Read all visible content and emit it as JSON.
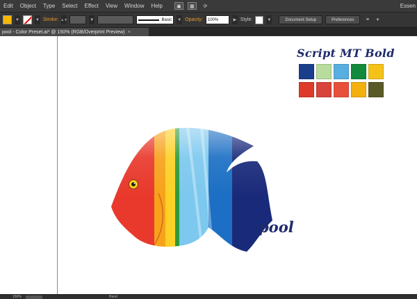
{
  "menu": {
    "items": [
      "Edit",
      "Object",
      "Type",
      "Select",
      "Effect",
      "View",
      "Window",
      "Help"
    ],
    "workspace": "Essen"
  },
  "control": {
    "stroke_label": "Stroke:",
    "brush_label": "Basic",
    "opacity_label": "Opacity:",
    "opacity_value": "100%",
    "style_label": "Style:",
    "document_setup": "Document Setup",
    "preferences": "Preferences"
  },
  "tab": {
    "title": "pool - Color Preset.ai* @ 150% (RGB/Overprint Preview)",
    "close": "×"
  },
  "artwork": {
    "font_title": "Script MT Bold",
    "logo_text": "pool",
    "swatches": [
      [
        "#1a3e8c",
        "#b8dc9c",
        "#58aee0",
        "#128a3c",
        "#f5c21a"
      ],
      [
        "#dd3a2a",
        "#d8443a",
        "#e8503c",
        "#f4b10e",
        "#5a5a28"
      ]
    ],
    "fish_colors": {
      "red": "#e8392c",
      "orange": "#f7a21b",
      "yellow": "#fbd126",
      "green": "#2e9a3c",
      "light_blue": "#7cc8ee",
      "blue": "#1c6fc4",
      "navy": "#1a2a7a"
    }
  },
  "status": {
    "zoom": "150%",
    "tool": "Hand"
  }
}
